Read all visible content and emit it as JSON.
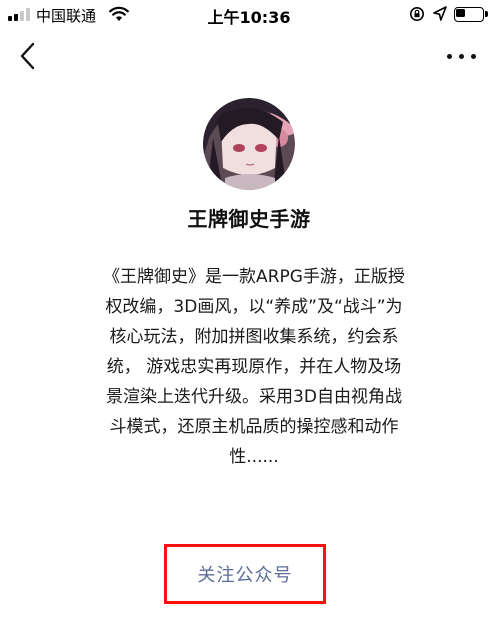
{
  "status_bar": {
    "carrier": "中国联通",
    "time": "上午10:36",
    "battery_level": 0.35,
    "signal_bars_active": 2,
    "signal_bars_total": 4
  },
  "nav": {
    "back_icon": "chevron-left-icon",
    "more_icon": "ellipsis-icon"
  },
  "profile": {
    "name": "王牌御史手游",
    "intro_lines": [
      "《王牌御史》是一款ARPG手游，正版授",
      "权改编，3D画风，以“养成”及“战斗”为",
      "核心玩法，附加拼图收集系统，约会系",
      "统， 游戏忠实再现原作，并在人物及场",
      "景渲染上迭代升级。采用3D自由视角战",
      "斗模式，还原主机品质的操控感和动作",
      "性......"
    ]
  },
  "actions": {
    "follow_label": "关注公众号",
    "highlight_color": "#ff0f0f",
    "link_color": "#5b6d98"
  }
}
